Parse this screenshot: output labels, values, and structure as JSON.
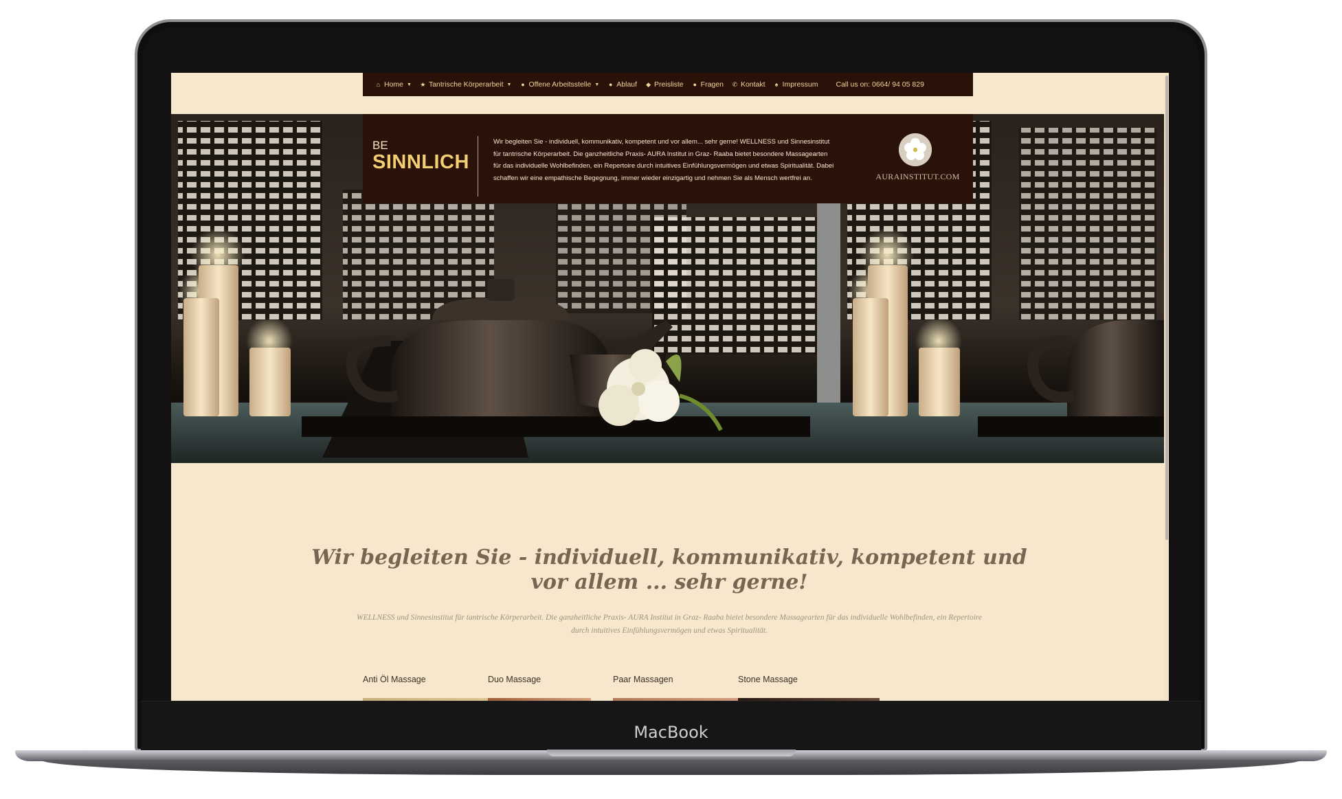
{
  "device": {
    "brand_label": "MacBook"
  },
  "nav": {
    "items": [
      {
        "label": "Home",
        "icon": "home-icon",
        "has_dropdown": true
      },
      {
        "label": "Tantrische Körperarbeit",
        "icon": "star-icon",
        "has_dropdown": true
      },
      {
        "label": "Offene Arbeitsstelle",
        "icon": "user-icon",
        "has_dropdown": true
      },
      {
        "label": "Ablauf",
        "icon": "info-circle-icon",
        "has_dropdown": false
      },
      {
        "label": "Preisliste",
        "icon": "tag-icon",
        "has_dropdown": false
      },
      {
        "label": "Fragen",
        "icon": "question-circle-icon",
        "has_dropdown": false
      },
      {
        "label": "Kontakt",
        "icon": "phone-icon",
        "has_dropdown": false
      },
      {
        "label": "Impressum",
        "icon": "award-icon",
        "has_dropdown": false
      }
    ],
    "phone": "Call us on: 0664/ 94 05 829"
  },
  "banner": {
    "prefix": "BE",
    "title": "SINNLICH",
    "text": "Wir begleiten Sie - individuell, kommunikativ, kompetent und vor allem... sehr gerne! WELLNESS und Sinnesinstitut für tantrische Körperarbeit. Die ganzheitliche Praxis- AURA Institut in Graz- Raaba bietet besondere Massagearten für das individuelle Wohlbefinden, ein Repertoire durch intuitives Einfühlungsvermögen und etwas Spiritualität. Dabei schaffen wir eine empathische Begegnung, immer wieder einzigartig und nehmen Sie als Mensch wertfrei an.",
    "logo_text": "AURAINSTITUT.COM"
  },
  "main": {
    "headline": "Wir begleiten Sie - individuell, kommunikativ, kompetent und vor allem ... sehr gerne!",
    "intro": "WELLNESS und Sinnesinstitut für tantrische Körperarbeit. Die ganzheitliche Praxis- AURA Institut in Graz- Raaba bietet besondere Massagearten für das individuelle Wohlbefinden, ein Repertoire durch intuitives Einfühlungsvermögen und etwas Spiritualität.",
    "services": [
      {
        "label": "Anti Öl Massage"
      },
      {
        "label": "Duo Massage"
      },
      {
        "label": "Paar Massagen"
      },
      {
        "label": "Stone Massage"
      }
    ]
  },
  "colors": {
    "page_background": "#f7e7cc",
    "nav_background": "#2b1209",
    "accent_gold": "#f2cf73",
    "headline_color": "#776653"
  }
}
